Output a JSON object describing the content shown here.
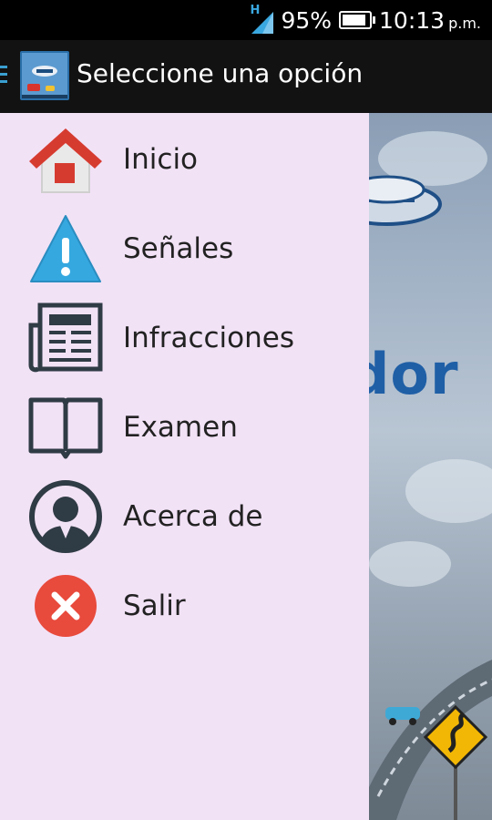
{
  "status_bar": {
    "network": "H",
    "battery": "95%",
    "battery_level": 0.95,
    "time": "10:13",
    "ampm": "p.m."
  },
  "action_bar": {
    "title": "Seleccione una opción",
    "app_icon": "app-logo-icon"
  },
  "background": {
    "word_fragment": "dor"
  },
  "drawer": {
    "items": [
      {
        "label": "Inicio",
        "icon": "home-icon",
        "color": "#d63b30"
      },
      {
        "label": "Señales",
        "icon": "warning-icon",
        "color": "#35a8e0"
      },
      {
        "label": "Infracciones",
        "icon": "newspaper-icon",
        "color": "#2f3b45"
      },
      {
        "label": "Examen",
        "icon": "book-icon",
        "color": "#2f3b45"
      },
      {
        "label": "Acerca de",
        "icon": "user-icon",
        "color": "#2f3b45"
      },
      {
        "label": "Salir",
        "icon": "close-icon",
        "color": "#e84a3c"
      }
    ]
  }
}
